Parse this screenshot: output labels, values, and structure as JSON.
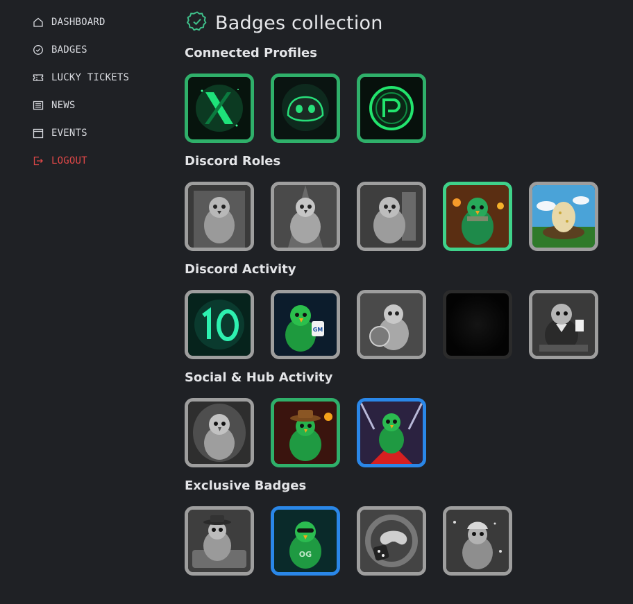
{
  "sidebar": {
    "items": [
      {
        "label": "DASHBOARD",
        "icon": "home-icon"
      },
      {
        "label": "BADGES",
        "icon": "badge-check-icon"
      },
      {
        "label": "LUCKY TICKETS",
        "icon": "ticket-icon"
      },
      {
        "label": "NEWS",
        "icon": "newspaper-icon"
      },
      {
        "label": "EVENTS",
        "icon": "calendar-icon"
      },
      {
        "label": "LOGOUT",
        "icon": "logout-icon"
      }
    ]
  },
  "header": {
    "title": "Badges collection",
    "icon": "badge-check-icon"
  },
  "colors": {
    "background": "#1f2125",
    "accent": "#3fbf8a",
    "logout": "#e04848",
    "border_grey": "#9e9e9e",
    "border_green": "#2fb06a",
    "border_blue": "#2a87e8"
  },
  "sections": [
    {
      "title": "Connected Profiles",
      "badges": [
        "x-profile-badge",
        "discord-profile-badge",
        "patreon-profile-badge"
      ]
    },
    {
      "title": "Discord Roles",
      "badges": [
        "owl-knight-badge",
        "owl-warrior-badge",
        "owl-armor-badge",
        "green-bird-badge",
        "golden-egg-badge"
      ]
    },
    {
      "title": "Discord Activity",
      "badges": [
        "ten-badge",
        "gm-bird-badge",
        "shield-bird-badge",
        "locked-dark-badge",
        "poker-bird-badge"
      ]
    },
    {
      "title": "Social & Hub Activity",
      "badges": [
        "eagle-cave-badge",
        "cowboy-bird-badge",
        "red-carpet-bird-badge"
      ]
    },
    {
      "title": "Exclusive Badges",
      "badges": [
        "gangster-bird-badge",
        "og-bird-badge",
        "game-controller-badge",
        "santa-bird-badge"
      ]
    }
  ]
}
